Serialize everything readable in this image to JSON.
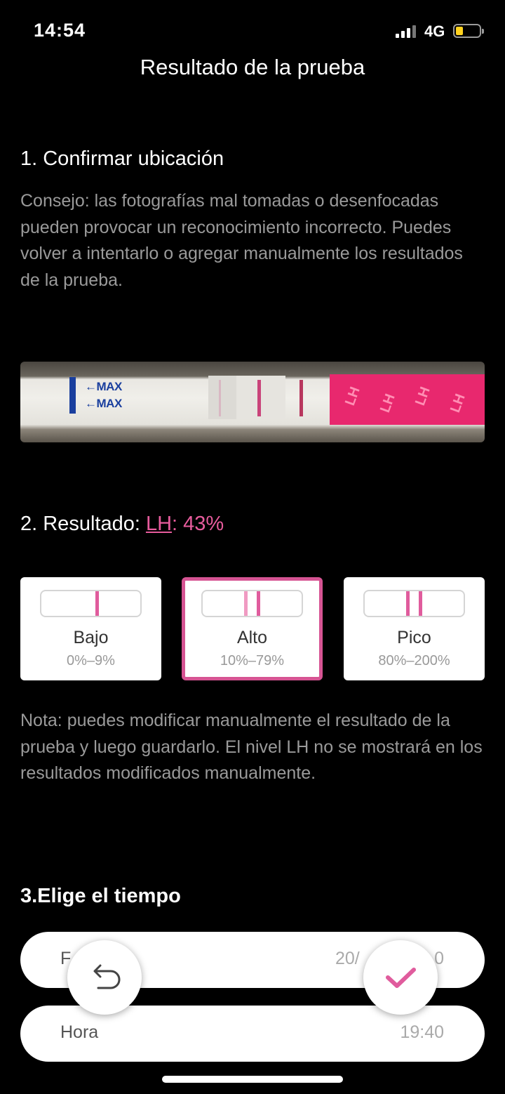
{
  "status_bar": {
    "time": "14:54",
    "network": "4G",
    "battery_color": "#ffd21f"
  },
  "header": {
    "title": "Resultado de la prueba"
  },
  "section1": {
    "heading": "1. Confirmar ubicación",
    "tip": "Consejo: las fotografías mal tomadas o desenfocadas pueden provocar un reconocimiento incorrecto. Puedes volver a intentarlo o agregar manualmente los resultados de la prueba."
  },
  "strip": {
    "marker_top": "MAX",
    "marker_bottom": "MAX",
    "brand": "LH",
    "image": "lh-test-strip-photo"
  },
  "section2": {
    "heading_prefix": "2. Resultado: ",
    "link_label": "LH",
    "value": ": 43%",
    "options": [
      {
        "label": "Bajo",
        "range": "0%–9%",
        "selected": false
      },
      {
        "label": "Alto",
        "range": "10%–79%",
        "selected": true
      },
      {
        "label": "Pico",
        "range": "80%–200%",
        "selected": false
      }
    ],
    "note": "Nota: puedes modificar manualmente el resultado de la prueba y luego guardarlo. El nivel LH no se mostrará en los resultados modificados manualmente."
  },
  "section3": {
    "heading": "3.Elige el tiempo",
    "fecha_label": "F",
    "fecha_value_start": "20/",
    "fecha_value_end": "0",
    "hora_label": "Hora",
    "hora_value": "19:40"
  },
  "fabs": {
    "undo_icon": "undo-icon",
    "confirm_icon": "checkmark-icon"
  },
  "colors": {
    "accent": "#e85c9d",
    "selected_border": "#d65493",
    "background": "#000000",
    "muted_text": "#9a9a9a"
  }
}
